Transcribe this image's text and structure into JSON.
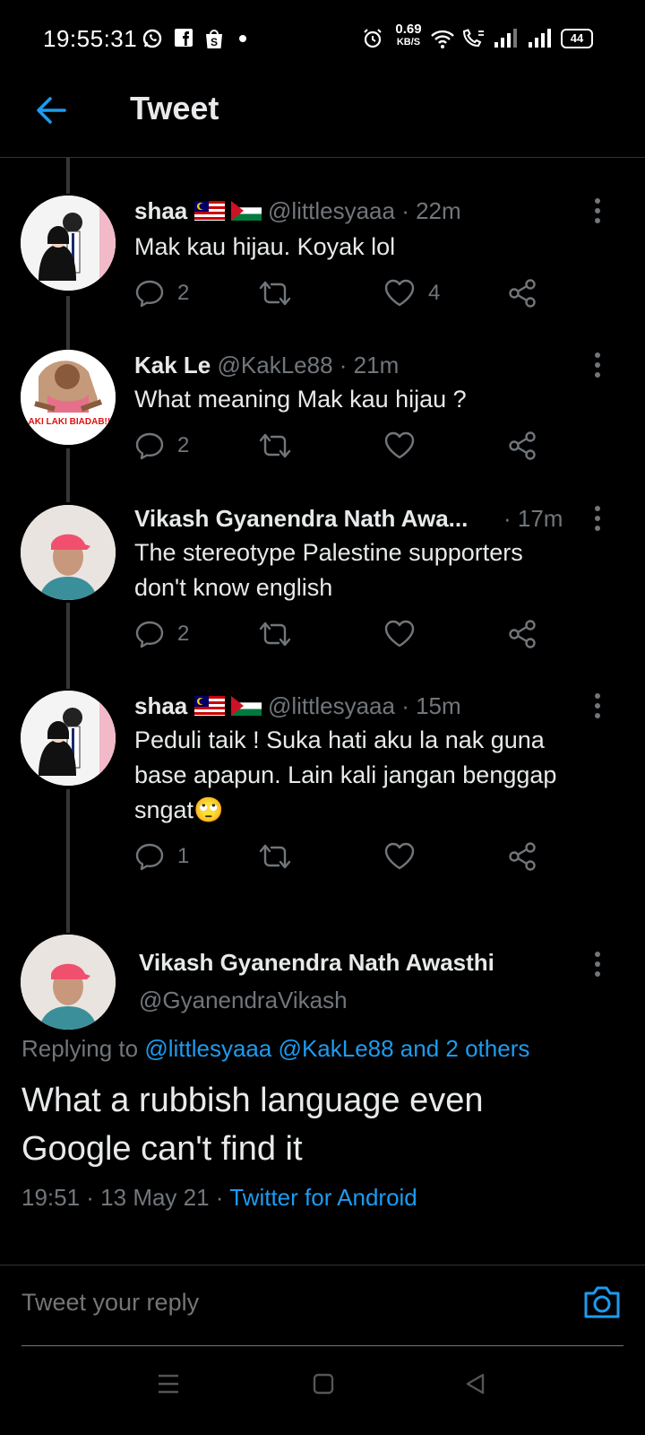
{
  "status_bar": {
    "time": "19:55:31",
    "net_speed_value": "0.69",
    "net_speed_unit": "KB/S",
    "battery": "44"
  },
  "header": {
    "title": "Tweet"
  },
  "replies": [
    {
      "name": "shaa",
      "handle": "@littlesyaaa",
      "time": "· 22m",
      "text": "Mak kau hijau. Koyak lol",
      "reply_count": "2",
      "like_count": "4",
      "flags": true
    },
    {
      "name": "Kak Le",
      "handle": "@KakLe88",
      "time": "· 21m",
      "text": "What meaning Mak kau hijau ?",
      "reply_count": "2",
      "like_count": "",
      "avatar_text": "LAKI LAKI BIADAB!!!"
    },
    {
      "name": "Vikash Gyanendra Nath Awa...",
      "handle": "",
      "time": "· 17m",
      "text_line1": "The stereotype Palestine supporters",
      "text_line2": "don't know english",
      "reply_count": "2",
      "like_count": ""
    },
    {
      "name": "shaa",
      "handle": "@littlesyaaa",
      "time": "· 15m",
      "text_line1": "Peduli taik ! Suka hati aku la nak guna",
      "text_line2": "base apapun. Lain kali jangan benggap",
      "text_line3": "sngat🙄",
      "reply_count": "1",
      "like_count": "",
      "flags": true
    }
  ],
  "main_tweet": {
    "name": "Vikash Gyanendra Nath Awasthi",
    "handle": "@GyanendraVikash",
    "replying_to_label": "Replying to",
    "replying_to_users": "@littlesyaaa @KakLe88 and 2 others",
    "text_line1": "What a rubbish language even",
    "text_line2": "Google can't find it",
    "timestamp": "19:51 · 13 May 21 ·",
    "source": "Twitter for Android"
  },
  "reply_bar": {
    "placeholder": "Tweet your reply"
  },
  "colors": {
    "accent": "#1d9bf0",
    "muted": "#71767b",
    "text": "#e7e9ea",
    "background": "#000000"
  }
}
